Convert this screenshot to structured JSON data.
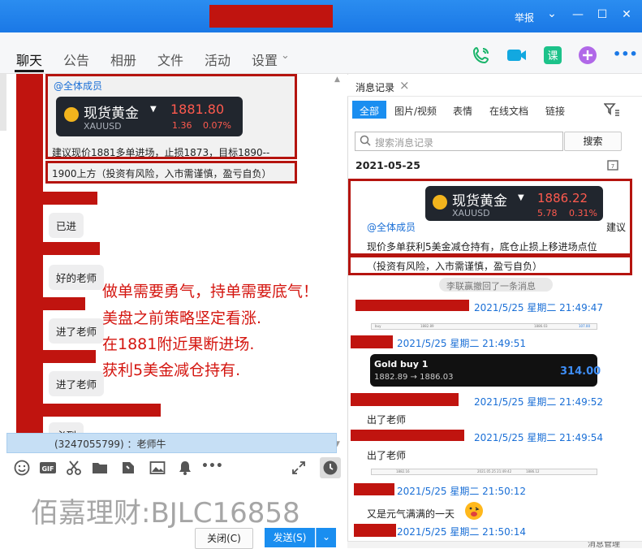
{
  "titlebar": {
    "report_label": "举报",
    "chevron": "⌄",
    "minimize": "—",
    "maximize": "☐",
    "close": "✕"
  },
  "nav": {
    "tabs": [
      "聊天",
      "公告",
      "相册",
      "文件",
      "活动",
      "设置"
    ],
    "settings_chevron": "⌄",
    "more": "•••"
  },
  "chat": {
    "mention": "@全体成员",
    "gold_card": {
      "name": "现货黄金",
      "symbol": "XAUUSD",
      "price": "1881.80",
      "change": "1.36",
      "change_pct": "0.07%"
    },
    "msg_line1": "建议现价1881多单进场，止损1873，目标1890--",
    "msg_line2": "1900上方（投资有风险，入市需谨慎，盈亏自负）",
    "bubbles": [
      "已进",
      "好的老师",
      "进了老师",
      "进了老师",
      "必到"
    ],
    "overlay_lines": [
      "做单需要勇气，持单需要底气！",
      "美盘之前策略坚定看涨.",
      "在1881附近果断进场.",
      "获利5美金减仓持有."
    ],
    "quote_bar": "(3247055799) ：老师牛",
    "scroll_up": "▲",
    "scroll_down": "▼"
  },
  "watermark": "佰嘉理财:BJLC16858",
  "buttons": {
    "close_label": "关闭(C)",
    "send_label": "发送(S)",
    "send_arrow": "⌄"
  },
  "history": {
    "title": "消息记录",
    "close": "×",
    "filter_tabs": [
      "全部",
      "图片/视频",
      "表情",
      "在线文档",
      "链接"
    ],
    "search_placeholder": "搜索消息记录",
    "search_button": "搜索",
    "date": "2021-05-25",
    "gold_card": {
      "name": "现货黄金",
      "symbol": "XAUUSD",
      "price": "1886.22",
      "change": "5.78",
      "change_pct": "0.31%"
    },
    "mention": "@全体成员",
    "suggest": "建议",
    "msg_line1": "现价多单获利5美金减仓持有，底仓止损上移进场点位",
    "msg_line2": "（投资有风险，入市需谨慎，盈亏自负）",
    "recall_notice": "李联赢撤回了一条消息",
    "entries": [
      {
        "time": "2021/5/25 星期二 21:49:47"
      },
      {
        "time": "2021/5/25 星期二 21:49:51"
      },
      {
        "time": "2021/5/25 星期二 21:49:52"
      },
      {
        "time": "2021/5/25 星期二 21:49:54"
      },
      {
        "time": "2021/5/25 星期二 21:50:12"
      },
      {
        "time": "2021/5/25 星期二 21:50:14"
      }
    ],
    "trade_card": {
      "title": "Gold buy 1",
      "route": "1882.89 → 1886.03",
      "profit": "314.00"
    },
    "texts": [
      "出了老师",
      "出了老师",
      "又是元气满满的一天"
    ],
    "mini_chart1": [
      "buy",
      "1882.89",
      "1886.03",
      "107.00"
    ],
    "mini_chart2": [
      "1882.16",
      "2021.05.25 21:49:42",
      "1886.12"
    ],
    "footer_label": "消息管理"
  },
  "colors": {
    "title_blue": "#1a78e6",
    "accent_red": "#b5140f",
    "link_blue": "#1a6fd6"
  }
}
